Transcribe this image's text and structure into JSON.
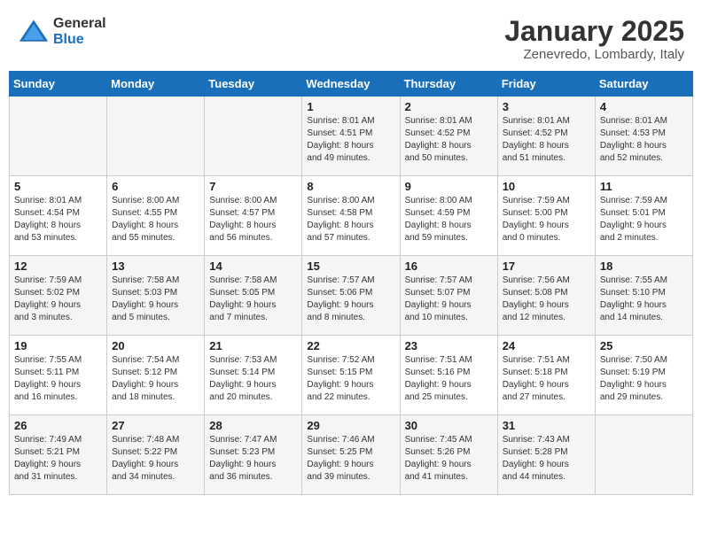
{
  "header": {
    "logo_general": "General",
    "logo_blue": "Blue",
    "title": "January 2025",
    "subtitle": "Zenevredo, Lombardy, Italy"
  },
  "weekdays": [
    "Sunday",
    "Monday",
    "Tuesday",
    "Wednesday",
    "Thursday",
    "Friday",
    "Saturday"
  ],
  "weeks": [
    [
      {
        "day": "",
        "info": ""
      },
      {
        "day": "",
        "info": ""
      },
      {
        "day": "",
        "info": ""
      },
      {
        "day": "1",
        "info": "Sunrise: 8:01 AM\nSunset: 4:51 PM\nDaylight: 8 hours\nand 49 minutes."
      },
      {
        "day": "2",
        "info": "Sunrise: 8:01 AM\nSunset: 4:52 PM\nDaylight: 8 hours\nand 50 minutes."
      },
      {
        "day": "3",
        "info": "Sunrise: 8:01 AM\nSunset: 4:52 PM\nDaylight: 8 hours\nand 51 minutes."
      },
      {
        "day": "4",
        "info": "Sunrise: 8:01 AM\nSunset: 4:53 PM\nDaylight: 8 hours\nand 52 minutes."
      }
    ],
    [
      {
        "day": "5",
        "info": "Sunrise: 8:01 AM\nSunset: 4:54 PM\nDaylight: 8 hours\nand 53 minutes."
      },
      {
        "day": "6",
        "info": "Sunrise: 8:00 AM\nSunset: 4:55 PM\nDaylight: 8 hours\nand 55 minutes."
      },
      {
        "day": "7",
        "info": "Sunrise: 8:00 AM\nSunset: 4:57 PM\nDaylight: 8 hours\nand 56 minutes."
      },
      {
        "day": "8",
        "info": "Sunrise: 8:00 AM\nSunset: 4:58 PM\nDaylight: 8 hours\nand 57 minutes."
      },
      {
        "day": "9",
        "info": "Sunrise: 8:00 AM\nSunset: 4:59 PM\nDaylight: 8 hours\nand 59 minutes."
      },
      {
        "day": "10",
        "info": "Sunrise: 7:59 AM\nSunset: 5:00 PM\nDaylight: 9 hours\nand 0 minutes."
      },
      {
        "day": "11",
        "info": "Sunrise: 7:59 AM\nSunset: 5:01 PM\nDaylight: 9 hours\nand 2 minutes."
      }
    ],
    [
      {
        "day": "12",
        "info": "Sunrise: 7:59 AM\nSunset: 5:02 PM\nDaylight: 9 hours\nand 3 minutes."
      },
      {
        "day": "13",
        "info": "Sunrise: 7:58 AM\nSunset: 5:03 PM\nDaylight: 9 hours\nand 5 minutes."
      },
      {
        "day": "14",
        "info": "Sunrise: 7:58 AM\nSunset: 5:05 PM\nDaylight: 9 hours\nand 7 minutes."
      },
      {
        "day": "15",
        "info": "Sunrise: 7:57 AM\nSunset: 5:06 PM\nDaylight: 9 hours\nand 8 minutes."
      },
      {
        "day": "16",
        "info": "Sunrise: 7:57 AM\nSunset: 5:07 PM\nDaylight: 9 hours\nand 10 minutes."
      },
      {
        "day": "17",
        "info": "Sunrise: 7:56 AM\nSunset: 5:08 PM\nDaylight: 9 hours\nand 12 minutes."
      },
      {
        "day": "18",
        "info": "Sunrise: 7:55 AM\nSunset: 5:10 PM\nDaylight: 9 hours\nand 14 minutes."
      }
    ],
    [
      {
        "day": "19",
        "info": "Sunrise: 7:55 AM\nSunset: 5:11 PM\nDaylight: 9 hours\nand 16 minutes."
      },
      {
        "day": "20",
        "info": "Sunrise: 7:54 AM\nSunset: 5:12 PM\nDaylight: 9 hours\nand 18 minutes."
      },
      {
        "day": "21",
        "info": "Sunrise: 7:53 AM\nSunset: 5:14 PM\nDaylight: 9 hours\nand 20 minutes."
      },
      {
        "day": "22",
        "info": "Sunrise: 7:52 AM\nSunset: 5:15 PM\nDaylight: 9 hours\nand 22 minutes."
      },
      {
        "day": "23",
        "info": "Sunrise: 7:51 AM\nSunset: 5:16 PM\nDaylight: 9 hours\nand 25 minutes."
      },
      {
        "day": "24",
        "info": "Sunrise: 7:51 AM\nSunset: 5:18 PM\nDaylight: 9 hours\nand 27 minutes."
      },
      {
        "day": "25",
        "info": "Sunrise: 7:50 AM\nSunset: 5:19 PM\nDaylight: 9 hours\nand 29 minutes."
      }
    ],
    [
      {
        "day": "26",
        "info": "Sunrise: 7:49 AM\nSunset: 5:21 PM\nDaylight: 9 hours\nand 31 minutes."
      },
      {
        "day": "27",
        "info": "Sunrise: 7:48 AM\nSunset: 5:22 PM\nDaylight: 9 hours\nand 34 minutes."
      },
      {
        "day": "28",
        "info": "Sunrise: 7:47 AM\nSunset: 5:23 PM\nDaylight: 9 hours\nand 36 minutes."
      },
      {
        "day": "29",
        "info": "Sunrise: 7:46 AM\nSunset: 5:25 PM\nDaylight: 9 hours\nand 39 minutes."
      },
      {
        "day": "30",
        "info": "Sunrise: 7:45 AM\nSunset: 5:26 PM\nDaylight: 9 hours\nand 41 minutes."
      },
      {
        "day": "31",
        "info": "Sunrise: 7:43 AM\nSunset: 5:28 PM\nDaylight: 9 hours\nand 44 minutes."
      },
      {
        "day": "",
        "info": ""
      }
    ]
  ]
}
